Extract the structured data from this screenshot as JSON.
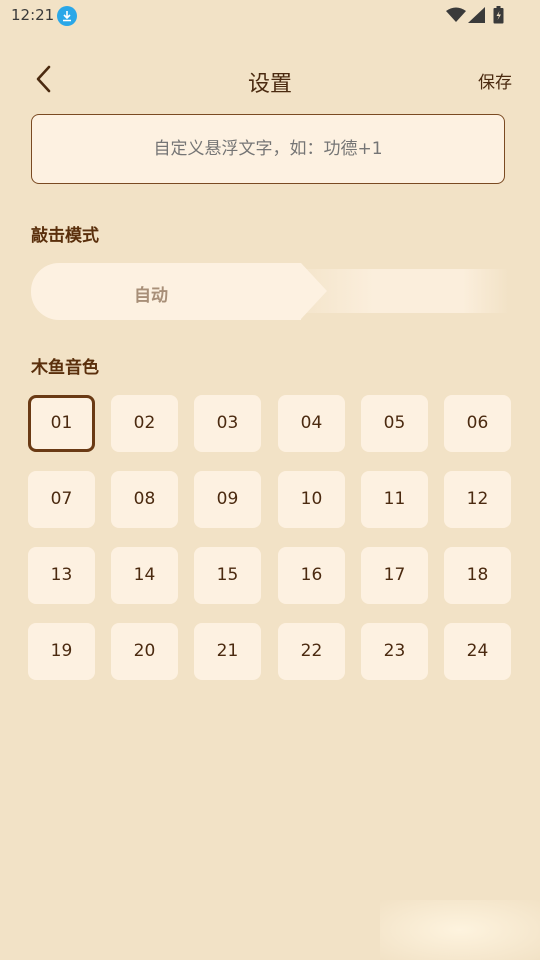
{
  "status_bar": {
    "time": "12:21"
  },
  "header": {
    "title": "设置",
    "save_label": "保存"
  },
  "float_text": {
    "value": "",
    "placeholder": "自定义悬浮文字，如：功德+1"
  },
  "knock_mode": {
    "label": "敲击模式",
    "selected": "自动"
  },
  "sound": {
    "label": "木鱼音色",
    "selected": "01",
    "tiles": [
      "01",
      "02",
      "03",
      "04",
      "05",
      "06",
      "07",
      "08",
      "09",
      "10",
      "11",
      "12",
      "13",
      "14",
      "15",
      "16",
      "17",
      "18",
      "19",
      "20",
      "21",
      "22",
      "23",
      "24"
    ]
  },
  "colors": {
    "background": "#f2e2c6",
    "tile": "#fdf1e1",
    "accent": "#6a3a14",
    "download_badge": "#2aa7e8"
  }
}
